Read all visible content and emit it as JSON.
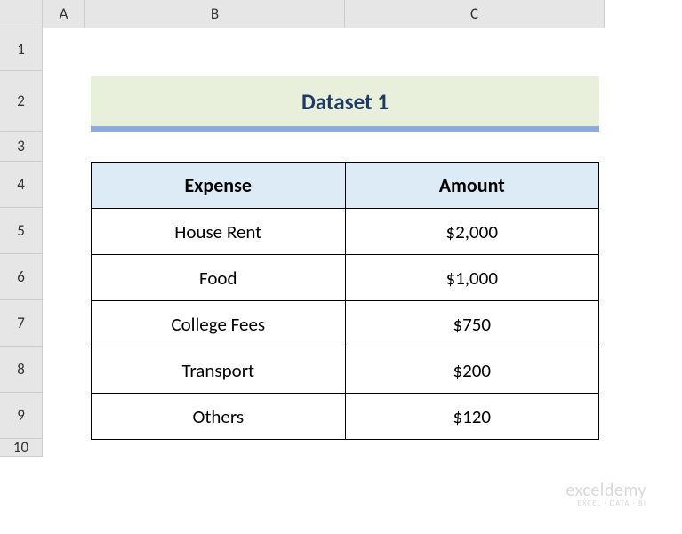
{
  "columns": [
    "",
    "A",
    "B",
    "C"
  ],
  "rows": [
    "1",
    "2",
    "3",
    "4",
    "5",
    "6",
    "7",
    "8",
    "9",
    "10"
  ],
  "title": "Dataset 1",
  "table": {
    "headers": [
      "Expense",
      "Amount"
    ],
    "data": [
      {
        "expense": "House Rent",
        "amount": "$2,000"
      },
      {
        "expense": "Food",
        "amount": "$1,000"
      },
      {
        "expense": "College Fees",
        "amount": "$750"
      },
      {
        "expense": "Transport",
        "amount": "$200"
      },
      {
        "expense": "Others",
        "amount": "$120"
      }
    ]
  },
  "watermark": {
    "big": "exceldemy",
    "small": "EXCEL · DATA · BI"
  }
}
